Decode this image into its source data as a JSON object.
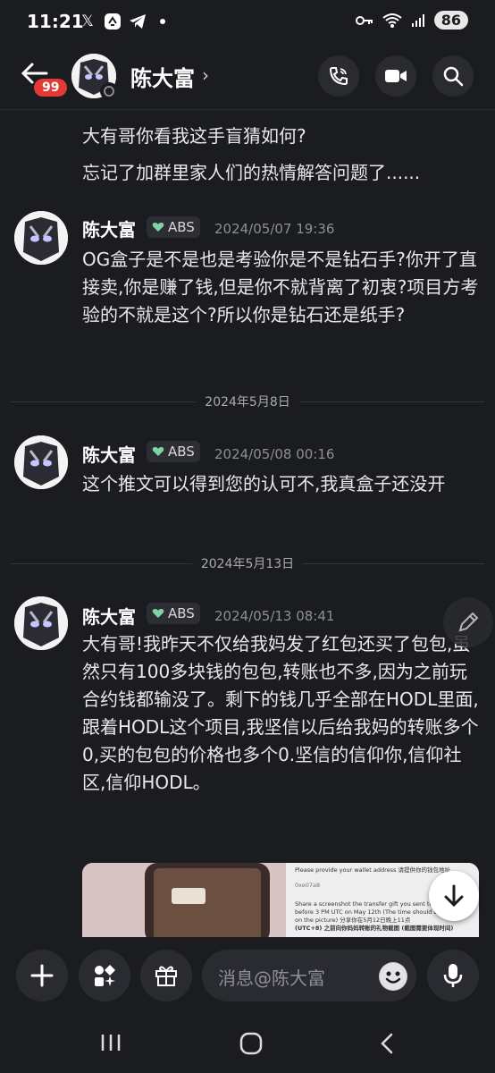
{
  "status_bar": {
    "time": "11:21",
    "battery": "86"
  },
  "header": {
    "contact_name": "陈大富",
    "unread_badge": "99"
  },
  "feed": {
    "continuation_lines": [
      "大有哥你看我这手盲猜如何?",
      "忘记了加群里家人们的热情解答问题了......"
    ],
    "messages": [
      {
        "author": "陈大富",
        "tag": "ABS",
        "timestamp": "2024/05/07 19:36",
        "text": "OG盒子是不是也是考验你是不是钻石手?你开了直接卖,你是赚了钱,但是你不就背离了初衷?项目方考验的不就是这个?所以你是钻石还是纸手?"
      },
      {
        "author": "陈大富",
        "tag": "ABS",
        "timestamp": "2024/05/08 00:16",
        "text": "这个推文可以得到您的认可不,我真盒子还没开"
      },
      {
        "author": "陈大富",
        "tag": "ABS",
        "timestamp": "2024/05/13 08:41",
        "text": "大有哥!我昨天不仅给我妈发了红包还买了包包,虽然只有100多块钱的包包,转账也不多,因为之前玩合约钱都输没了。剩下的钱几乎全部在HODL里面,跟着HODL这个项目,我坚信以后给我妈的转账多个0,买的包包的价格也多个0.坚信的信仰你,信仰社区,信仰HODL。"
      }
    ],
    "date_separators": [
      "2024年5月8日",
      "2024年5月13日"
    ],
    "attachment_preview": {
      "line1": "Please provide your wallet address 请提供你的钱包地址",
      "line2": "0xe07a8",
      "line3": "Share a screenshot the transfer gift you sent to your mom before 3 PM UTC on May 12th (The time should be shown on the picture) 分享你在5月12日晚上11点",
      "line4": "(UTC+8) 之前向你妈妈转账的礼物截图 (截图需要体现时间)"
    }
  },
  "composer": {
    "placeholder": "消息@陈大富"
  },
  "colors": {
    "background": "#1b1c20",
    "surface": "#2a2b30",
    "badge_red": "#e53935",
    "heart_green": "#7fd3a6",
    "muted_text": "#8e8f95"
  }
}
